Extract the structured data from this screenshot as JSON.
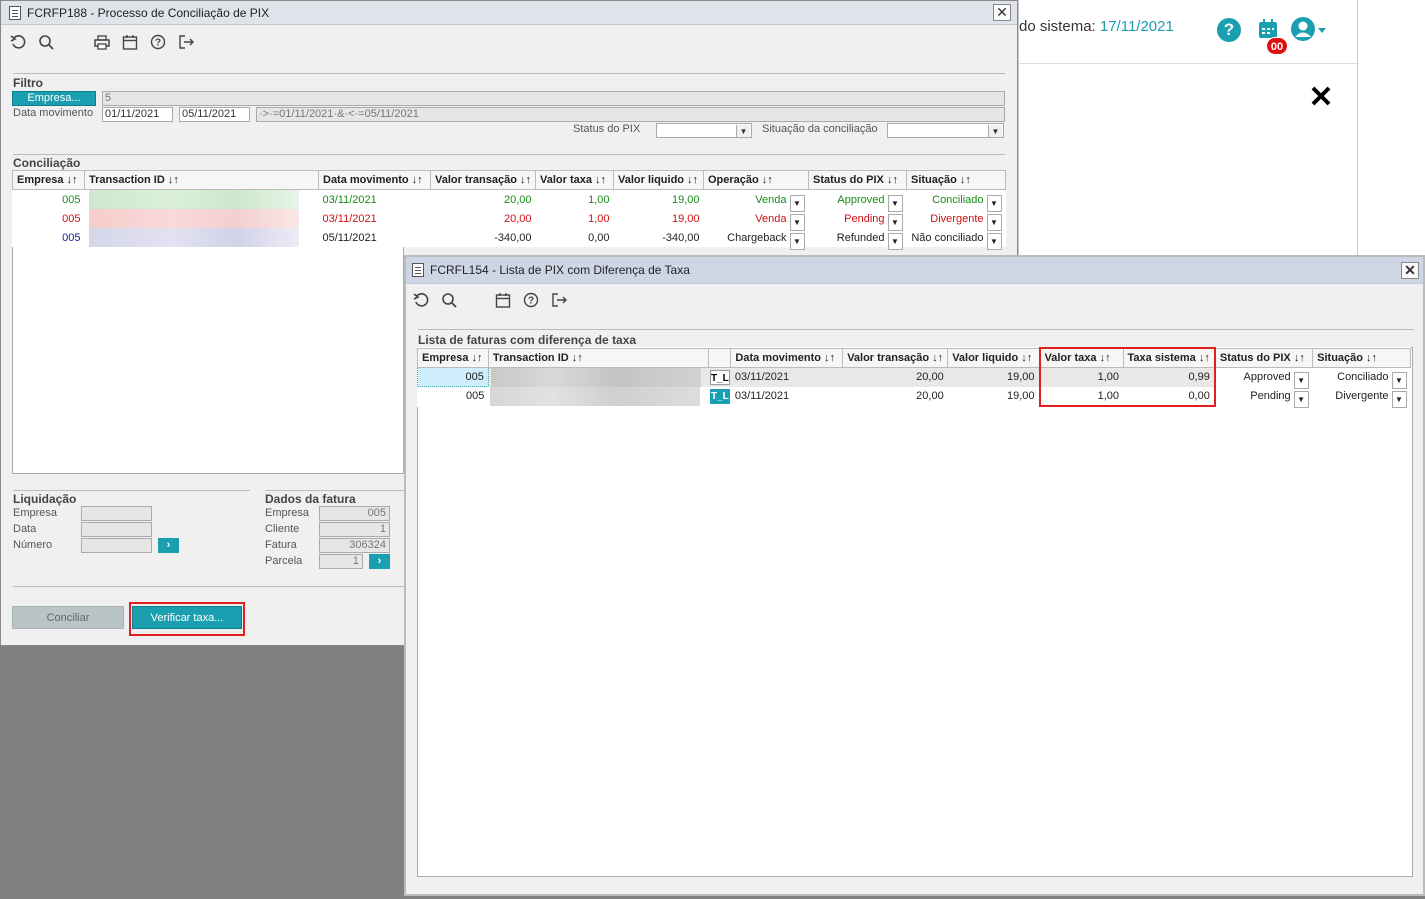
{
  "bg": {
    "datebar_label": "do sistema:",
    "date": "17/11/2021",
    "badge": "00",
    "help_glyph": "?"
  },
  "win1": {
    "title": "FCRFP188 - Processo de Conciliação de PIX",
    "filter": {
      "section": "Filtro",
      "empresa_button": "Empresa...",
      "empresa_value": "5",
      "data_label": "Data movimento",
      "date_from": "01/11/2021",
      "date_to": "05/11/2021",
      "date_expr": "·>·=01/11/2021·&·<·=05/11/2021",
      "status_label": "Status do PIX",
      "status_value": "",
      "situacao_label": "Situação da conciliação",
      "situacao_value": ""
    },
    "conc": {
      "section": "Conciliação",
      "headers": [
        "Empresa ↓↑",
        "Transaction ID ↓↑",
        "Data movimento ↓↑",
        "Valor transação ↓↑",
        "Valor taxa ↓↑",
        "Valor liquido ↓↑",
        "Operação ↓↑",
        "Status do PIX ↓↑",
        "Situação ↓↑"
      ],
      "rows": [
        {
          "empresa": "005",
          "data": "03/11/2021",
          "valor": "20,00",
          "taxa": "1,00",
          "liquido": "19,00",
          "operacao": "Venda",
          "status": "Approved",
          "situacao": "Conciliado"
        },
        {
          "empresa": "005",
          "data": "03/11/2021",
          "valor": "20,00",
          "taxa": "1,00",
          "liquido": "19,00",
          "operacao": "Venda",
          "status": "Pending",
          "situacao": "Divergente"
        },
        {
          "empresa": "005",
          "data": "05/11/2021",
          "valor": "-340,00",
          "taxa": "0,00",
          "liquido": "-340,00",
          "operacao": "Chargeback",
          "status": "Refunded",
          "situacao": "Não conciliado"
        }
      ]
    },
    "liq": {
      "section": "Liquidação",
      "empresa": "Empresa",
      "data": "Data",
      "numero": "Número"
    },
    "fatura": {
      "section": "Dados da fatura",
      "empresa_label": "Empresa",
      "empresa": "005",
      "cliente_label": "Cliente",
      "cliente": "1",
      "fatura_label": "Fatura",
      "fatura": "306324",
      "parcela_label": "Parcela",
      "parcela": "1"
    },
    "btn_conciliar": "Conciliar",
    "btn_verificar": "Verificar taxa..."
  },
  "win2": {
    "title": "FCRFL154 - Lista de PIX com Diferença de Taxa",
    "section": "Lista de faturas com diferença de taxa",
    "headers": [
      "Empresa ↓↑",
      "Transaction ID ↓↑",
      "",
      "Data movimento ↓↑",
      "Valor transação ↓↑",
      "Valor liquido ↓↑",
      "Valor taxa ↓↑",
      "Taxa sistema ↓↑",
      "Status do PIX ↓↑",
      "Situação ↓↑"
    ],
    "rows": [
      {
        "empresa": "005",
        "tl": "T_L",
        "data": "03/11/2021",
        "valor": "20,00",
        "liquido": "19,00",
        "taxa": "1,00",
        "sistema": "0,99",
        "status": "Approved",
        "situacao": "Conciliado"
      },
      {
        "empresa": "005",
        "tl": "T_L",
        "data": "03/11/2021",
        "valor": "20,00",
        "liquido": "19,00",
        "taxa": "1,00",
        "sistema": "0,00",
        "status": "Pending",
        "situacao": "Divergente"
      }
    ]
  },
  "colors": {
    "accent": "#1a9fb0",
    "highlight": "#e02020",
    "green": "#1a8a1a",
    "red": "#d01010",
    "blue": "#1a1a8a"
  }
}
